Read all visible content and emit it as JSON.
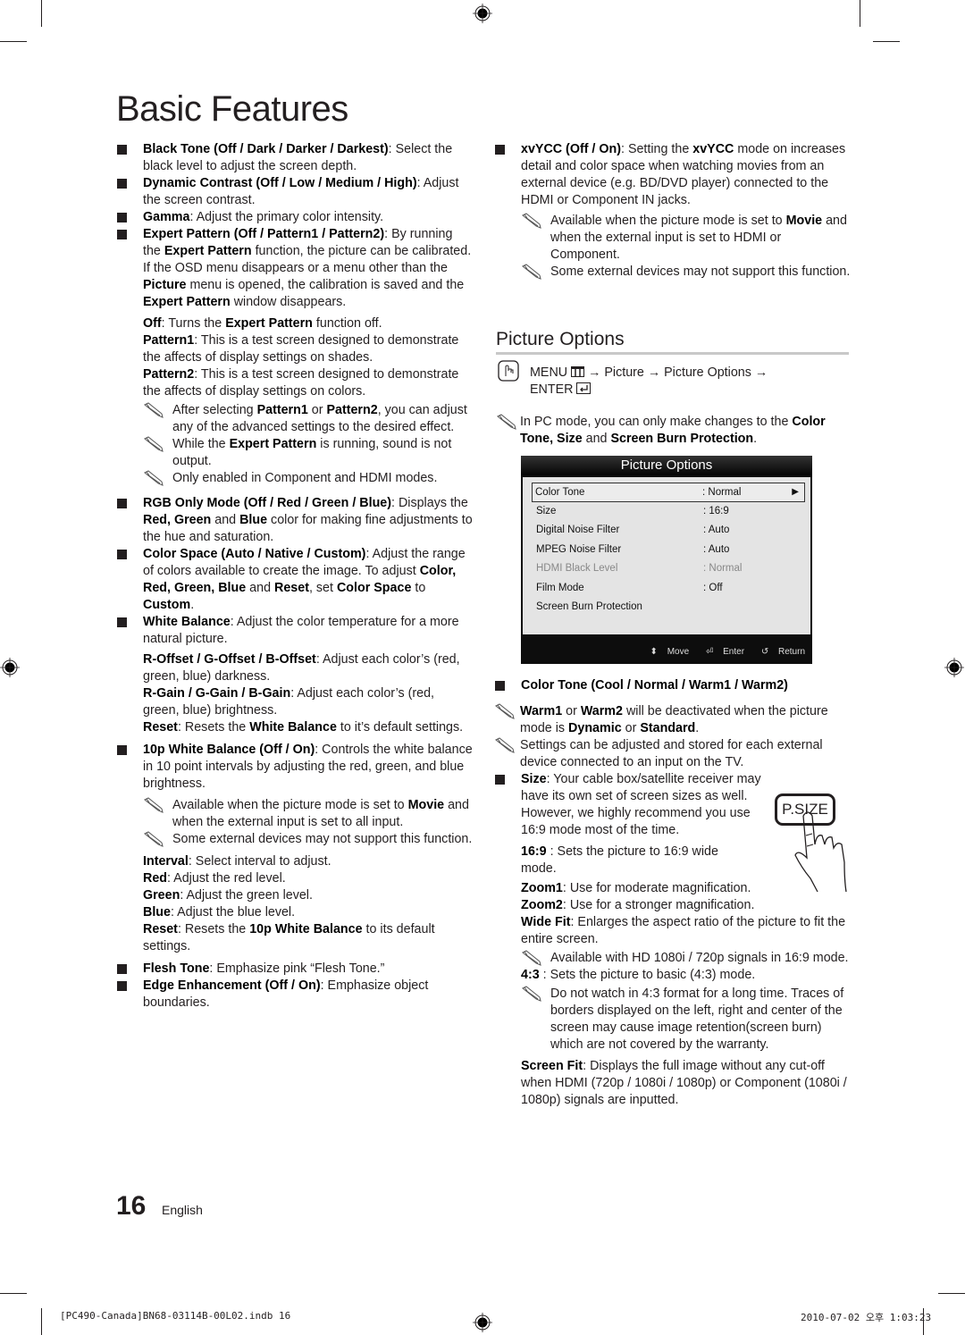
{
  "page": {
    "title": "Basic Features",
    "page_number": "16",
    "language": "English",
    "footer_file": "[PC490-Canada]BN68-03114B-00L02.indb   16",
    "footer_date": "2010-07-02   오후 1:03:23"
  },
  "left": {
    "black_tone": {
      "label": "Black Tone (Off / Dark / Darker / Darkest)",
      "text": ": Select the black level to adjust the screen depth."
    },
    "dynamic_contrast": {
      "label": "Dynamic Contrast (Off / Low / Medium / High)",
      "text": ": Adjust the screen contrast."
    },
    "gamma": {
      "label": "Gamma",
      "text": ": Adjust the primary color intensity."
    },
    "expert_pattern": {
      "label": "Expert Pattern (Off / Pattern1 / Pattern2)",
      "t1": ": By running the ",
      "b1": "Expert Pattern",
      "t2": " function, the picture can be calibrated. If the OSD menu disappears or a menu other than the ",
      "b2": "Picture",
      "t3": " menu is opened, the calibration is saved and the ",
      "b3": "Expert Pattern",
      "t4": " window disappears.",
      "off_label": "Off",
      "off_t1": ": Turns the ",
      "off_b": "Expert Pattern",
      "off_t2": " function off.",
      "p1_label": "Pattern1",
      "p1_text": ": This is a test screen designed to demonstrate the affects of display settings on shades.",
      "p2_label": "Pattern2",
      "p2_text": ": This is a test screen designed to demonstrate the affects of display settings on colors.",
      "note1_t1": "After selecting ",
      "note1_b1": "Pattern1",
      "note1_t2": " or ",
      "note1_b2": "Pattern2",
      "note1_t3": ", you can adjust any of the advanced settings to the desired effect.",
      "note2_t1": "While the ",
      "note2_b": "Expert Pattern",
      "note2_t2": " is running, sound is not output.",
      "note3": "Only enabled in Component and HDMI modes."
    },
    "rgb_only": {
      "label": "RGB Only Mode (Off / Red / Green / Blue)",
      "t1": ": Displays the ",
      "b1": "Red, Green",
      "t2": " and ",
      "b2": "Blue",
      "t3": " color for making fine adjustments to the hue and saturation."
    },
    "color_space": {
      "label": "Color Space (Auto / Native / Custom)",
      "t1": ": Adjust the range of colors available to create the image. To adjust ",
      "b1": "Color, Red, Green, Blue",
      "t2": " and ",
      "b2": "Reset",
      "t3": ", set ",
      "b3": "Color Space",
      "t4": " to ",
      "b4": "Custom",
      "t5": "."
    },
    "white_balance": {
      "label": "White Balance",
      "text": ": Adjust the color temperature for a more natural picture.",
      "offset_label": "R-Offset / G-Offset / B-Offset",
      "offset_text": ": Adjust each color’s (red, green, blue) darkness.",
      "gain_label": "R-Gain / G-Gain / B-Gain",
      "gain_text": ": Adjust each color’s (red, green, blue) brightness.",
      "reset_label": "Reset",
      "reset_t1": ": Resets the ",
      "reset_b": "White Balance",
      "reset_t2": " to it’s default settings."
    },
    "wb10": {
      "label": "10p White Balance (Off / On)",
      "text": ": Controls the white balance in 10 point intervals by adjusting the red, green, and blue brightness.",
      "note1_t1": "Available when the picture mode is set to ",
      "note1_b": "Movie",
      "note1_t2": " and when the external input is set to all input.",
      "note2": "Some external devices may not support this function.",
      "interval_label": "Interval",
      "interval_text": ": Select interval to adjust.",
      "red_label": "Red",
      "red_text": ": Adjust the red level.",
      "green_label": "Green",
      "green_text": ": Adjust the green level.",
      "blue_label": "Blue",
      "blue_text": ": Adjust the blue level.",
      "reset_label": "Reset",
      "reset_t1": ": Resets the ",
      "reset_b": "10p White Balance",
      "reset_t2": " to its default settings."
    },
    "flesh_tone": {
      "label": "Flesh Tone",
      "text": ": Emphasize pink “Flesh Tone.”"
    },
    "edge": {
      "label": "Edge Enhancement (Off / On)",
      "text": ": Emphasize object boundaries."
    }
  },
  "right": {
    "xvycc": {
      "label": "xvYCC (Off / On)",
      "t1": ": Setting the ",
      "b1": "xvYCC",
      "t2": " mode on increases detail and color space when watching movies from an external device (e.g. BD/DVD player) connected to the HDMI or Component IN jacks.",
      "note1_t1": "Available when the picture mode is set to ",
      "note1_b": "Movie",
      "note1_t2": " and when the external input is set to HDMI or Component.",
      "note2": "Some external devices may not support this function."
    },
    "section_title": "Picture Options",
    "menu_path": {
      "menu": "MENU",
      "arrow": "→",
      "p1": "Picture",
      "p2": "Picture Options",
      "enter": "ENTER"
    },
    "pc_note": {
      "t1": "In PC mode, you can only make changes to the ",
      "b1": "Color Tone, Size",
      "t2": " and ",
      "b2": "Screen Burn Protection",
      "t3": "."
    },
    "osd": {
      "title": "Picture Options",
      "rows": [
        {
          "label": "Color Tone",
          "value": ": Normal"
        },
        {
          "label": "Size",
          "value": ": 16:9"
        },
        {
          "label": "Digital Noise Filter",
          "value": ": Auto"
        },
        {
          "label": "MPEG Noise Filter",
          "value": ": Auto"
        },
        {
          "label": "HDMI Black Level",
          "value": ": Normal"
        },
        {
          "label": "Film Mode",
          "value": ": Off"
        },
        {
          "label": "Screen Burn Protection",
          "value": ""
        }
      ],
      "footer": {
        "move": "Move",
        "enter": "Enter",
        "return": "Return"
      }
    },
    "color_tone": {
      "label": "Color Tone (Cool / Normal / Warm1 / Warm2)",
      "note1_b1": "Warm1",
      "note1_t1": " or ",
      "note1_b2": "Warm2",
      "note1_t2": " will be deactivated when the picture mode is ",
      "note1_b3": "Dynamic",
      "note1_t3": " or ",
      "note1_b4": "Standard",
      "note1_t4": ".",
      "note2": "Settings can be adjusted and stored for each external device connected to an input on the TV."
    },
    "size": {
      "label": "Size",
      "text": ": Your cable box/satellite receiver may have its own set of screen sizes as well. However, we highly recommend you use 16:9 mode most of the time.",
      "psize_button": "P.SIZE",
      "r169_label": "16:9",
      "r169_text": " : Sets the picture to 16:9 wide mode.",
      "zoom1_label": "Zoom1",
      "zoom1_text": ": Use for moderate magnification.",
      "zoom2_label": "Zoom2",
      "zoom2_text": ": Use for a stronger magnification.",
      "wide_label": "Wide Fit",
      "wide_text": ": Enlarges the aspect ratio of the picture to fit the entire screen.",
      "wide_note": "Available with HD 1080i / 720p signals in 16:9 mode.",
      "r43_label": "4:3",
      "r43_text": " : Sets the picture to basic (4:3) mode.",
      "r43_note": "Do not watch in 4:3 format for a long time. Traces of borders displayed on the left, right and center of the screen may cause image retention(screen burn) which are not covered by the warranty.",
      "screenfit_label": "Screen Fit",
      "screenfit_text": ": Displays the full image without any cut-off when HDMI (720p / 1080i / 1080p) or Component (1080i / 1080p) signals are inputted."
    }
  }
}
